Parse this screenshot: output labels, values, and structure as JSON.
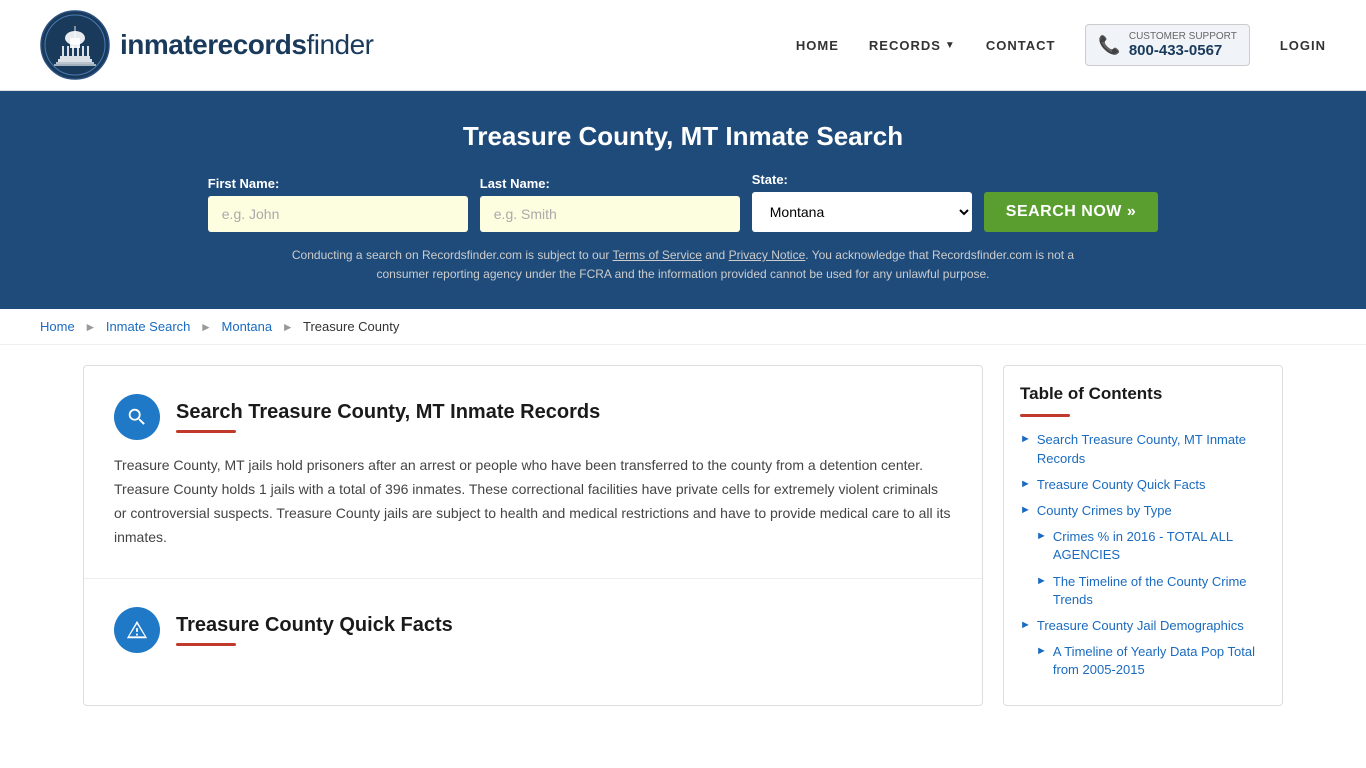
{
  "header": {
    "logo_text_light": "inmaterecords",
    "logo_text_bold": "finder",
    "nav": {
      "home": "HOME",
      "records": "RECORDS",
      "contact": "CONTACT",
      "login": "LOGIN"
    },
    "customer_support": {
      "label": "CUSTOMER SUPPORT",
      "phone": "800-433-0567"
    }
  },
  "hero": {
    "title": "Treasure County, MT Inmate Search",
    "form": {
      "first_name_label": "First Name:",
      "first_name_placeholder": "e.g. John",
      "last_name_label": "Last Name:",
      "last_name_placeholder": "e.g. Smith",
      "state_label": "State:",
      "state_value": "Montana",
      "state_options": [
        "Montana"
      ],
      "search_button": "SEARCH NOW »"
    },
    "disclaimer": "Conducting a search on Recordsfinder.com is subject to our Terms of Service and Privacy Notice. You acknowledge that Recordsfinder.com is not a consumer reporting agency under the FCRA and the information provided cannot be used for any unlawful purpose."
  },
  "breadcrumb": {
    "items": [
      "Home",
      "Inmate Search",
      "Montana",
      "Treasure County"
    ]
  },
  "article": {
    "sections": [
      {
        "icon": "search",
        "title": "Search Treasure County, MT Inmate Records",
        "body": "Treasure County, MT jails hold prisoners after an arrest or people who have been transferred to the county from a detention center. Treasure County holds 1 jails with a total of 396 inmates. These correctional facilities have private cells for extremely violent criminals or controversial suspects. Treasure County jails are subject to health and medical restrictions and have to provide medical care to all its inmates."
      },
      {
        "icon": "info",
        "title": "Treasure County Quick Facts",
        "body": ""
      }
    ]
  },
  "toc": {
    "title": "Table of Contents",
    "items": [
      {
        "label": "Search Treasure County, MT Inmate Records",
        "sub": false
      },
      {
        "label": "Treasure County Quick Facts",
        "sub": false
      },
      {
        "label": "County Crimes by Type",
        "sub": false
      },
      {
        "label": "Crimes % in 2016 - TOTAL ALL AGENCIES",
        "sub": true
      },
      {
        "label": "The Timeline of the County Crime Trends",
        "sub": true
      },
      {
        "label": "Treasure County Jail Demographics",
        "sub": false
      },
      {
        "label": "A Timeline of Yearly Data Pop Total from 2005-2015",
        "sub": true
      }
    ]
  }
}
